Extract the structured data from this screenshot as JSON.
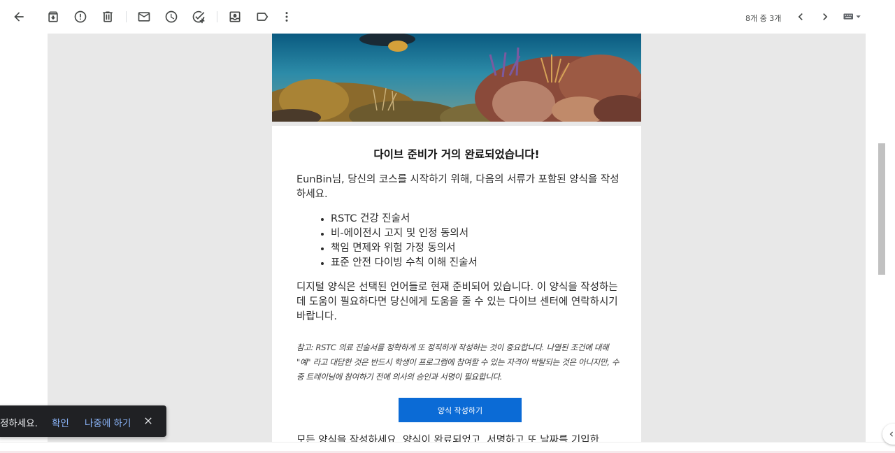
{
  "toolbar": {
    "back": "back-icon",
    "archive": "archive-icon",
    "spam": "report-spam-icon",
    "delete": "delete-icon",
    "unread": "mark-unread-icon",
    "snooze": "snooze-icon",
    "add_task": "add-task-icon",
    "move": "move-to-icon",
    "label": "label-icon",
    "more": "more-vert-icon",
    "pager": "8개 중 3개"
  },
  "email": {
    "title": "다이브 준비가 거의 완료되었습니다!",
    "intro": "EunBin님, 당신의 코스를 시작하기 위해, 다음의 서류가 포함된 양식을 작성하세요.",
    "forms": [
      "RSTC 건강 진술서",
      "비-에이전시 고지 및 인정 동의서",
      "책임 면제와 위험 가정 동의서",
      "표준 안전 다이빙 수칙 이해 진술서"
    ],
    "digital_note": "디지털 양식은 선택된 언어들로 현재 준비되어 있습니다. 이 양식을 작성하는데 도움이 필요하다면 당신에게 도움을 줄 수 있는 다이브 센터에 연락하시기 바랍니다.",
    "caution": "참고: RSTC 의료 진술서를 정확하게 또 정직하게 작성하는 것이 중요합니다. 나열된 조건에 대해 \"예\" 라고 대답한 것은 반드시 학생이 프로그램에 참여할 수 있는 자격이 박탈되는 것은 아니지만, 수중 트레이닝에 참여하기 전에 의사의 승인과 서명이 필요합니다.",
    "cta": "양식 작성하기",
    "footer": "모든 양식을 작성하세요. 양식이 완료되었고, 서명하고 또 날짜를 기입한"
  },
  "snackbar": {
    "text": "정하세요.",
    "confirm": "확인",
    "later": "나중에 하기"
  }
}
